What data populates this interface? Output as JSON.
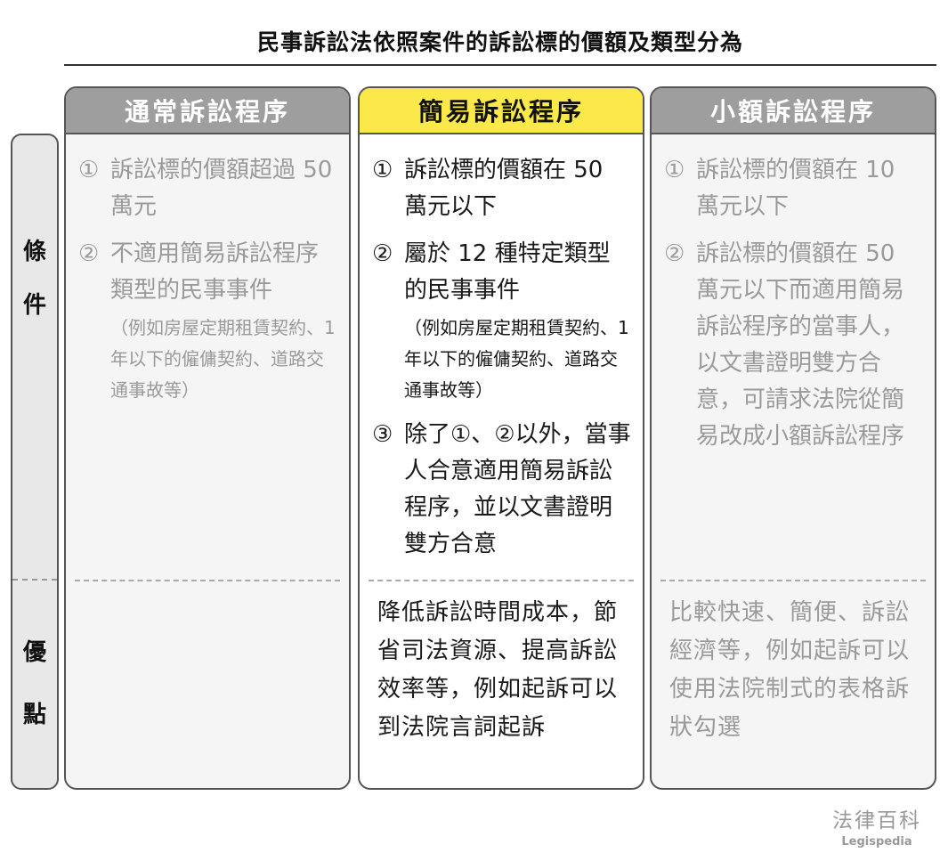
{
  "title": "民事訴訟法依照案件的訴訟標的價額及類型分為",
  "side": {
    "conditions": [
      "條",
      "件"
    ],
    "advantages": [
      "優",
      "點"
    ]
  },
  "columns": [
    {
      "header": "通常訴訟程序",
      "conditions": [
        {
          "num": "①",
          "text": "訴訟標的價額超過 50 萬元"
        },
        {
          "num": "②",
          "text": "不適用簡易訴訟程序類型的民事事件",
          "note": "（例如房屋定期租賃契約、1 年以下的僱傭契約、道路交通事故等）"
        }
      ],
      "advantage": ""
    },
    {
      "header": "簡易訴訟程序",
      "conditions": [
        {
          "num": "①",
          "text": "訴訟標的價額在 50 萬元以下"
        },
        {
          "num": "②",
          "text": "屬於 12 種特定類型的民事事件",
          "note": "（例如房屋定期租賃契約、1 年以下的僱傭契約、道路交通事故等）"
        },
        {
          "num": "③",
          "text": "除了①、②以外，當事人合意適用簡易訴訟程序，並以文書證明雙方合意"
        }
      ],
      "advantage": "降低訴訟時間成本，節省司法資源、提高訴訟效率等，例如起訴可以到法院言詞起訴"
    },
    {
      "header": "小額訴訟程序",
      "conditions": [
        {
          "num": "①",
          "text": "訴訟標的價額在 10 萬元以下"
        },
        {
          "num": "②",
          "text": "訴訟標的價額在 50 萬元以下而適用簡易訴訟程序的當事人，以文書證明雙方合意，可請求法院從簡易改成小額訴訟程序"
        }
      ],
      "advantage": "比較快速、簡便、訴訟經濟等，例如起訴可以使用法院制式的表格訴狀勾選"
    }
  ],
  "brand": {
    "name": "法律百科",
    "en": "Legispedia"
  },
  "colors": {
    "header_gray": "#9e9e9e",
    "header_highlight": "#fbe94a",
    "muted_text": "#9a9a9a"
  }
}
